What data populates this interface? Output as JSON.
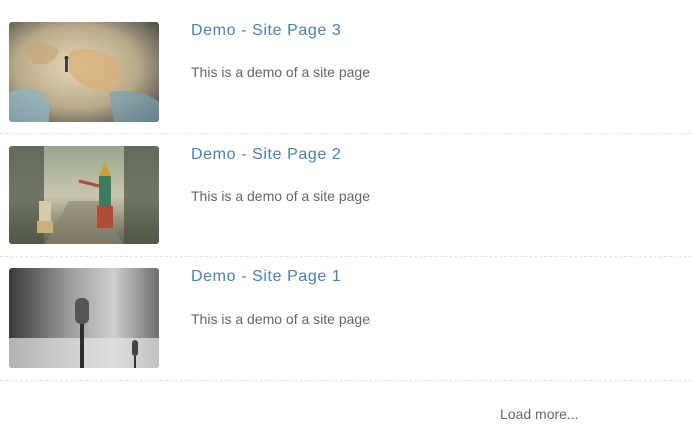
{
  "items": [
    {
      "title": "Demo - Site Page 3",
      "description": "This is a demo of a site page",
      "thumbnail_icon": "world-map-photo-icon"
    },
    {
      "title": "Demo - Site Page 2",
      "description": "This is a demo of a site page",
      "thumbnail_icon": "dancers-photo-icon"
    },
    {
      "title": "Demo - Site Page 1",
      "description": "This is a demo of a site page",
      "thumbnail_icon": "microphone-photo-icon"
    }
  ],
  "load_more_label": "Load more...",
  "colors": {
    "title_link": "#4a7fb0",
    "body_text": "#666666",
    "divider": "#e3e3e3"
  }
}
